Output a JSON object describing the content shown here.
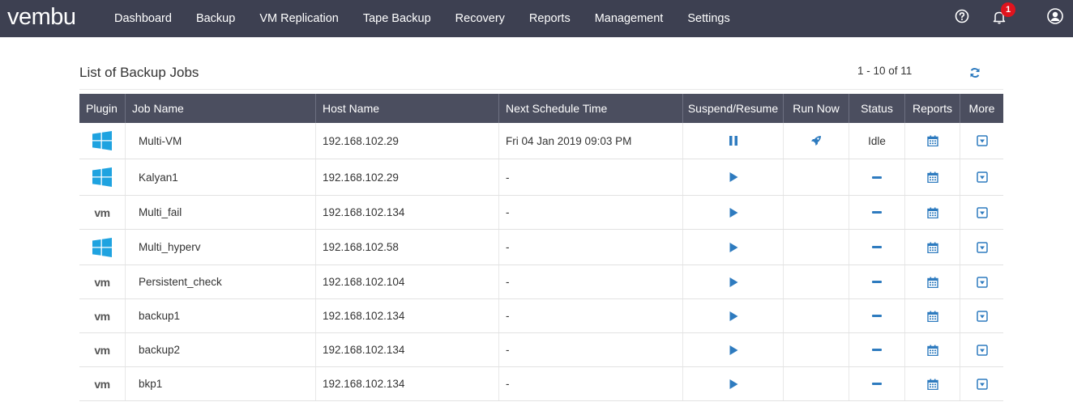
{
  "brand": {
    "logo": "vembu"
  },
  "nav": [
    {
      "label": "Dashboard"
    },
    {
      "label": "Backup"
    },
    {
      "label": "VM Replication"
    },
    {
      "label": "Tape Backup"
    },
    {
      "label": "Recovery"
    },
    {
      "label": "Reports"
    },
    {
      "label": "Management"
    },
    {
      "label": "Settings"
    }
  ],
  "top_icons": {
    "help": "help-icon",
    "notifications": "bell-icon",
    "notification_count": "1",
    "user": "user-icon"
  },
  "list": {
    "title": "List of Backup Jobs",
    "pager": "1 - 10 of 11",
    "refresh_icon": "refresh-icon"
  },
  "table": {
    "headers": [
      "Plugin",
      "Job Name",
      "Host Name",
      "Next Schedule Time",
      "Suspend/Resume",
      "Run Now",
      "Status",
      "Reports",
      "More"
    ],
    "rows": [
      {
        "plugin": "windows",
        "job": "Multi-VM",
        "host": "192.168.102.29",
        "next": "Fri 04 Jan 2019 09:03 PM",
        "suspend": "pause",
        "run_now": true,
        "status": "Idle"
      },
      {
        "plugin": "windows",
        "job": "Kalyan1",
        "host": "192.168.102.29",
        "next": "-",
        "suspend": "play",
        "run_now": false,
        "status": ""
      },
      {
        "plugin": "vm",
        "plugin_label": "vm",
        "job": "Multi_fail",
        "host": "192.168.102.134",
        "next": "-",
        "suspend": "play",
        "run_now": false,
        "status": ""
      },
      {
        "plugin": "windows",
        "job": "Multi_hyperv",
        "host": "192.168.102.58",
        "next": "-",
        "suspend": "play",
        "run_now": false,
        "status": ""
      },
      {
        "plugin": "vm",
        "plugin_label": "vm",
        "job": "Persistent_check",
        "host": "192.168.102.104",
        "next": "-",
        "suspend": "play",
        "run_now": false,
        "status": ""
      },
      {
        "plugin": "vm",
        "plugin_label": "vm",
        "job": "backup1",
        "host": "192.168.102.134",
        "next": "-",
        "suspend": "play",
        "run_now": false,
        "status": ""
      },
      {
        "plugin": "vm",
        "plugin_label": "vm",
        "job": "backup2",
        "host": "192.168.102.134",
        "next": "-",
        "suspend": "play",
        "run_now": false,
        "status": ""
      },
      {
        "plugin": "vm",
        "plugin_label": "vm",
        "job": "bkp1",
        "host": "192.168.102.134",
        "next": "-",
        "suspend": "play",
        "run_now": false,
        "status": ""
      }
    ]
  },
  "colors": {
    "nav_bg": "#3d4051",
    "header_bg": "#4b4e5f",
    "accent": "#2e7bbf",
    "windows_blue": "#1fa3e0",
    "badge": "#e0141e"
  }
}
